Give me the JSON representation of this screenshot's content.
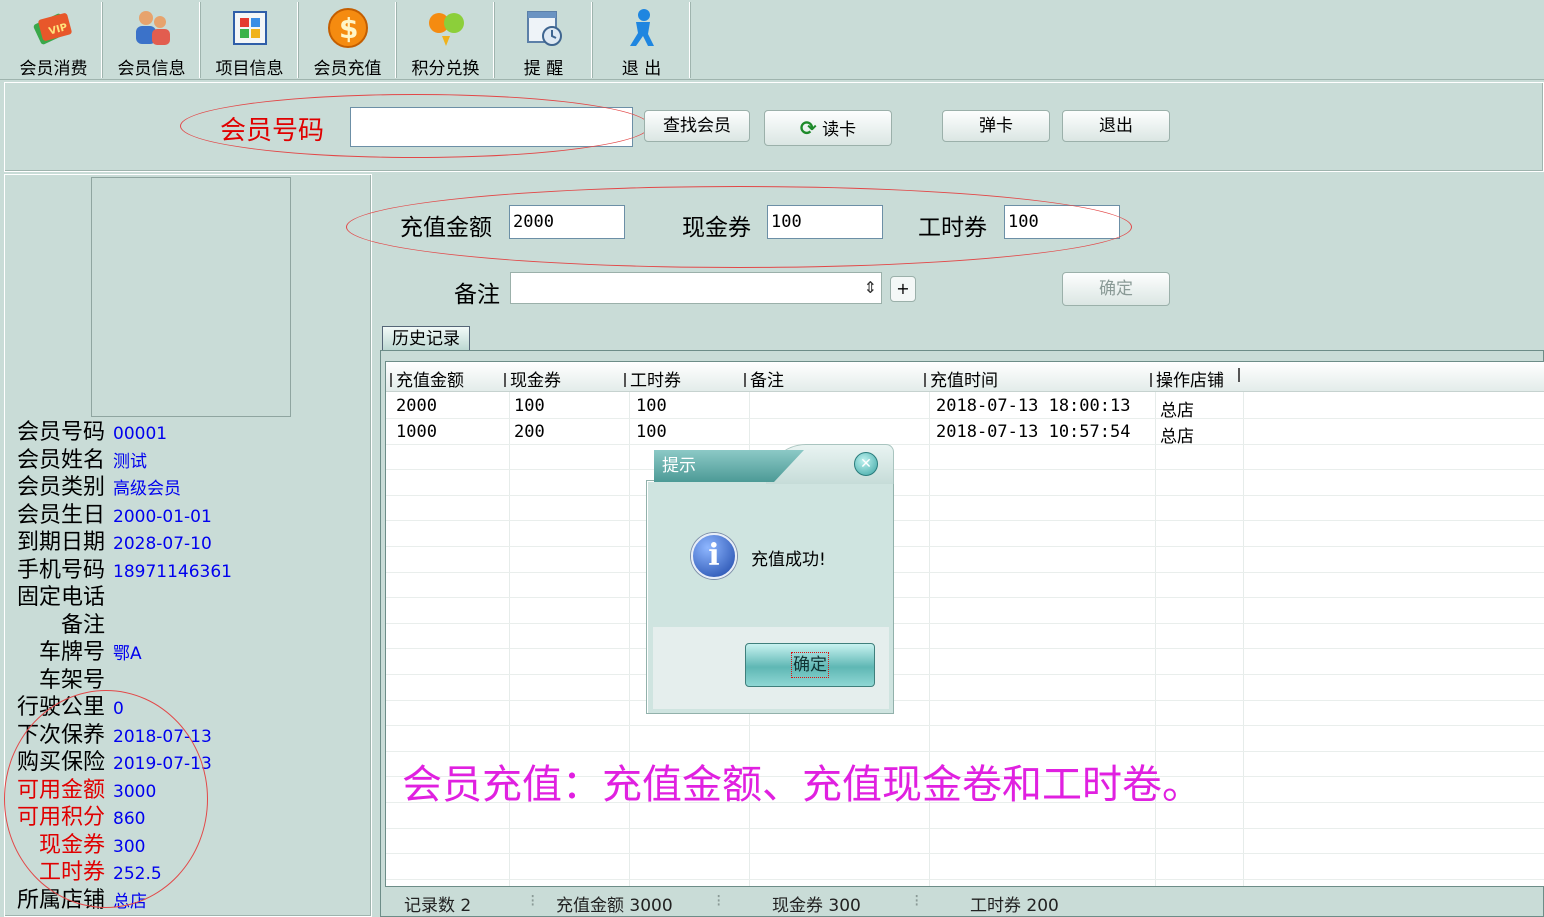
{
  "toolbar": {
    "items": [
      {
        "label": "会员消费",
        "icon": "vip-card-icon"
      },
      {
        "label": "会员信息",
        "icon": "users-icon"
      },
      {
        "label": "项目信息",
        "icon": "grid-icon"
      },
      {
        "label": "会员充值",
        "icon": "dollar-coin-icon"
      },
      {
        "label": "积分兑换",
        "icon": "exchange-icon"
      },
      {
        "label": "提 醒",
        "icon": "reminder-icon"
      },
      {
        "label": "退 出",
        "icon": "exit-person-icon"
      }
    ]
  },
  "search": {
    "member_label": "会员号码",
    "member_value": "",
    "find_btn": "查找会员",
    "read_card_btn": "读卡",
    "eject_card_btn": "弹卡",
    "exit_btn": "退出"
  },
  "member": {
    "rows": [
      {
        "key": "会员号码",
        "value": "00001",
        "red": false
      },
      {
        "key": "会员姓名",
        "value": "测试",
        "red": false
      },
      {
        "key": "会员类别",
        "value": "高级会员",
        "red": false
      },
      {
        "key": "会员生日",
        "value": "2000-01-01",
        "red": false
      },
      {
        "key": "到期日期",
        "value": "2028-07-10",
        "red": false
      },
      {
        "key": "手机号码",
        "value": "18971146361",
        "red": false
      },
      {
        "key": "固定电话",
        "value": "",
        "red": false
      },
      {
        "key": "备注",
        "value": "",
        "red": false
      },
      {
        "key": "车牌号",
        "value": "鄂A",
        "red": false
      },
      {
        "key": "车架号",
        "value": "",
        "red": false
      },
      {
        "key": "行驶公里",
        "value": "0",
        "red": false
      },
      {
        "key": "下次保养",
        "value": "2018-07-13",
        "red": false
      },
      {
        "key": "购买保险",
        "value": "2019-07-13",
        "red": false
      },
      {
        "key": "可用金额",
        "value": "3000",
        "red": true
      },
      {
        "key": "可用积分",
        "value": "860",
        "red": true
      },
      {
        "key": "现金券",
        "value": "300",
        "red": true
      },
      {
        "key": "工时券",
        "value": "252.5",
        "red": true
      },
      {
        "key": "所属店铺",
        "value": "总店",
        "red": false
      }
    ]
  },
  "recharge": {
    "amount_label": "充值金额",
    "amount_value": "2000",
    "cash_label": "现金券",
    "cash_value": "100",
    "labor_label": "工时券",
    "labor_value": "100",
    "note_label": "备注",
    "note_value": "",
    "plus_btn": "+",
    "confirm_btn": "确定"
  },
  "history": {
    "tab_label": "历史记录",
    "columns": [
      "充值金额",
      "现金券",
      "工时券",
      "备注",
      "充值时间",
      "操作店铺"
    ],
    "rows": [
      [
        "2000",
        "100",
        "100",
        "",
        "2018-07-13 18:00:13",
        "总店"
      ],
      [
        "1000",
        "200",
        "100",
        "",
        "2018-07-13 10:57:54",
        "总店"
      ]
    ]
  },
  "status": {
    "count": "记录数 2",
    "amount": "充值金额 3000",
    "cash": "现金券 300",
    "labor": "工时券 200"
  },
  "dialog": {
    "title": "提示",
    "message": "充值成功!",
    "ok_btn": "确定"
  },
  "annotation": "会员充值：充值金额、充值现金卷和工时卷。"
}
